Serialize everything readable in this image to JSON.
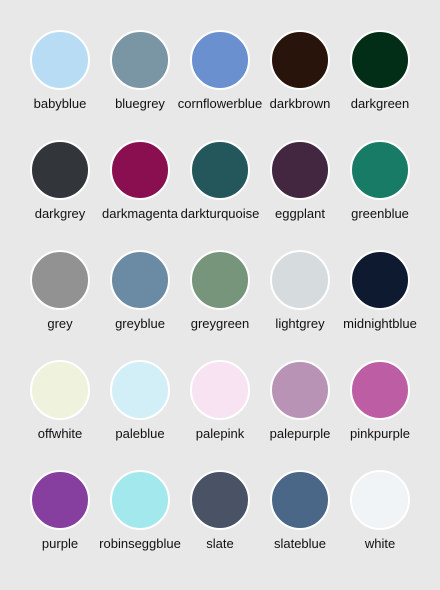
{
  "swatches": [
    {
      "name": "babyblue",
      "color": "#b7dcf4"
    },
    {
      "name": "bluegrey",
      "color": "#7a95a3"
    },
    {
      "name": "cornflowerblue",
      "color": "#6a90d0"
    },
    {
      "name": "darkbrown",
      "color": "#29140c"
    },
    {
      "name": "darkgreen",
      "color": "#022e18"
    },
    {
      "name": "darkgrey",
      "color": "#32353a"
    },
    {
      "name": "darkmagenta",
      "color": "#890f50"
    },
    {
      "name": "darkturquoise",
      "color": "#24575b"
    },
    {
      "name": "eggplant",
      "color": "#43263f"
    },
    {
      "name": "greenblue",
      "color": "#187b66"
    },
    {
      "name": "grey",
      "color": "#919291"
    },
    {
      "name": "greyblue",
      "color": "#6b8aa3"
    },
    {
      "name": "greygreen",
      "color": "#76957a"
    },
    {
      "name": "lightgrey",
      "color": "#d6dbde"
    },
    {
      "name": "midnightblue",
      "color": "#0d1a30"
    },
    {
      "name": "offwhite",
      "color": "#eff2dc"
    },
    {
      "name": "paleblue",
      "color": "#d2eef6"
    },
    {
      "name": "palepink",
      "color": "#f8e3f3"
    },
    {
      "name": "palepurple",
      "color": "#b893b5"
    },
    {
      "name": "pinkpurple",
      "color": "#bd5ea4"
    },
    {
      "name": "purple",
      "color": "#863f9f"
    },
    {
      "name": "robinseggblue",
      "color": "#a2e8ec"
    },
    {
      "name": "slate",
      "color": "#4a5265"
    },
    {
      "name": "slateblue",
      "color": "#4a6787"
    },
    {
      "name": "white",
      "color": "#f0f4f7"
    }
  ]
}
